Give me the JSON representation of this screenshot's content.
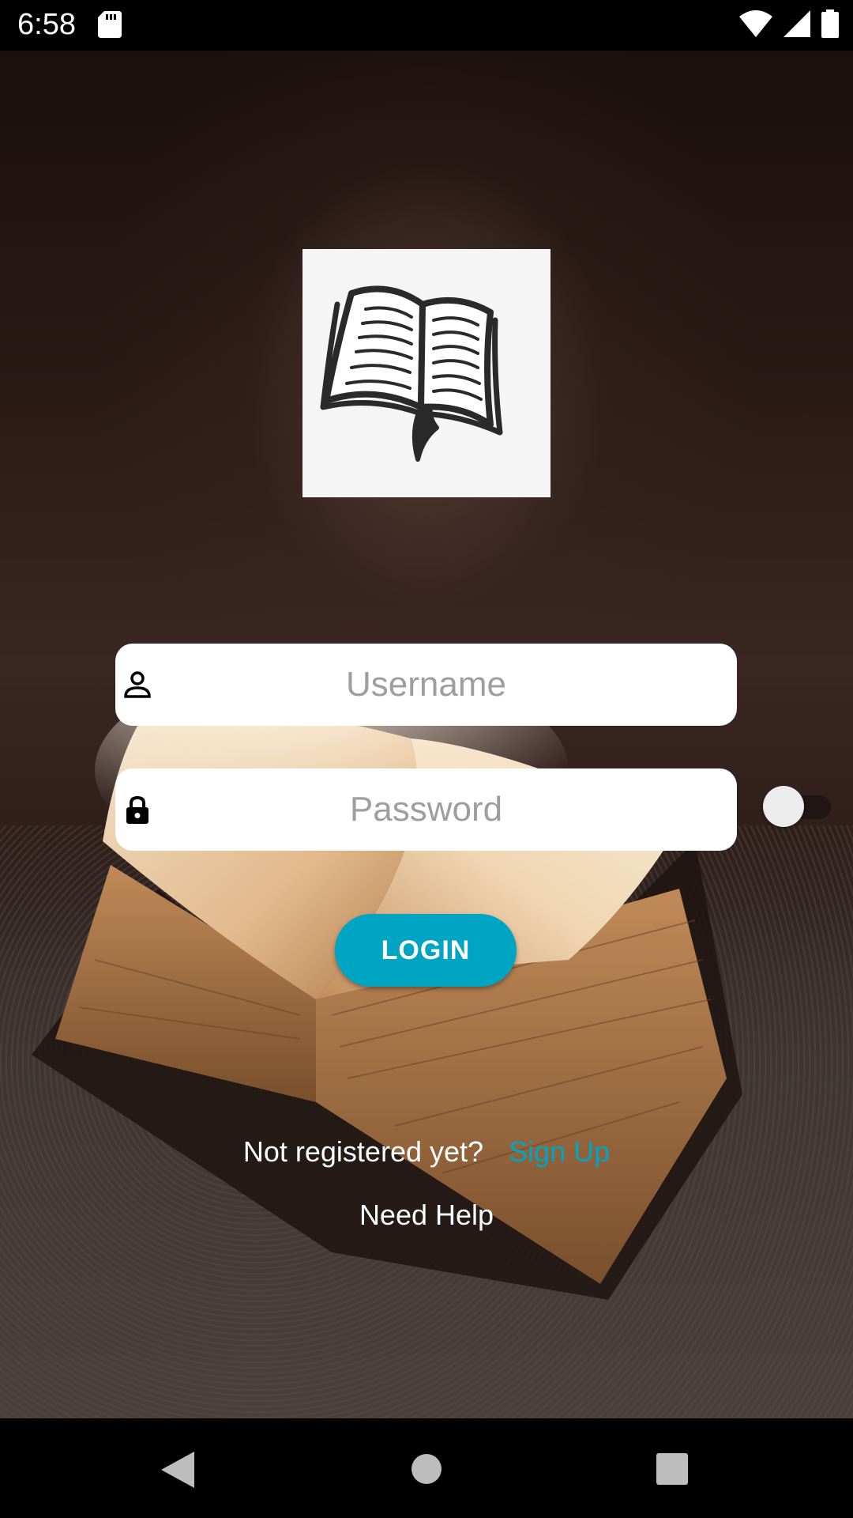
{
  "status_bar": {
    "time": "6:58",
    "icons": [
      "sd-card-icon",
      "wifi-icon",
      "cellular-signal-icon",
      "battery-icon"
    ]
  },
  "logo": {
    "icon": "open-book-icon",
    "background_color": "#f5f5f5"
  },
  "form": {
    "username": {
      "placeholder": "Username",
      "value": "",
      "icon": "person-icon"
    },
    "password": {
      "placeholder": "Password",
      "value": "",
      "icon": "lock-icon"
    },
    "show_password_toggle": {
      "checked": false
    },
    "login_label": "LOGIN"
  },
  "footer": {
    "register_prompt": "Not registered yet?",
    "signup_label": "Sign Up",
    "help_label": "Need Help"
  },
  "colors": {
    "accent": "#00a5c3",
    "text_on_dark": "#ffffff",
    "placeholder": "#9e9e9e"
  },
  "nav_bar": {
    "icons": [
      "back-icon",
      "home-icon",
      "recents-icon"
    ]
  }
}
